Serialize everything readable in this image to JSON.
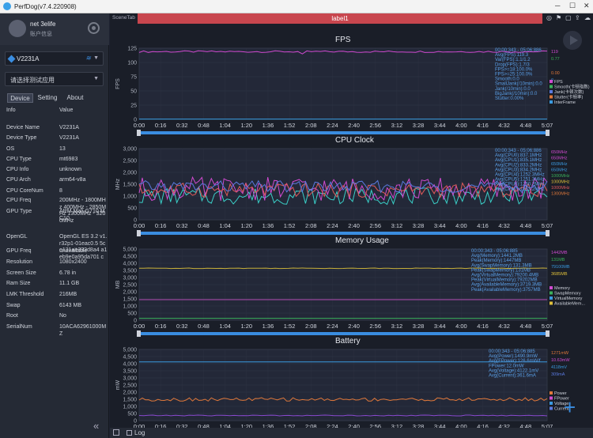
{
  "window": {
    "title": "PerfDog(v7.4.220908)"
  },
  "user": {
    "name": "net 3elife",
    "subtitle": "账户信息"
  },
  "device": {
    "name": "V2231A"
  },
  "app_select": {
    "placeholder": "请选择测试应用"
  },
  "tabs": [
    "Device",
    "Setting",
    "About"
  ],
  "table": {
    "headers": [
      "Info",
      "Value"
    ],
    "rows": [
      [
        "Device Name",
        "V2231A"
      ],
      [
        "Device Type",
        "V2231A"
      ],
      [
        "OS",
        "13"
      ],
      [
        "CPU Type",
        "mt6983"
      ],
      [
        "CPU Info",
        "unknown"
      ],
      [
        "CPU Arch",
        "arm64-v8a"
      ],
      [
        "CPU CoreNum",
        "8"
      ],
      [
        "CPU Freq",
        "200MHz - 1800MHz 400MHz - 2850MHz 1300MHz - 3200MHz"
      ],
      [
        "GPU Type",
        "ARM Mali-G710 MC10"
      ],
      [
        "OpenGL",
        "OpenGL ES 3.2 v1.r32p1-01eac0.5 5ce131ae332d8a4 a1eb9e0a95da701 c"
      ],
      [
        "GPU Freq",
        "unavailable"
      ],
      [
        "Resolution",
        "1080x2400"
      ],
      [
        "Screen Size",
        "6.78 in"
      ],
      [
        "Ram Size",
        "11.1 GB"
      ],
      [
        "LMK Threshold",
        "216MB"
      ],
      [
        "Swap",
        "6143 MB"
      ],
      [
        "Root",
        "No"
      ],
      [
        "SerialNum",
        "10ACA62961000MZ"
      ]
    ]
  },
  "scene_tab": "SceneTab",
  "label_bar": "label1",
  "log_label": "Log",
  "time_ticks": [
    "0:00",
    "0:16",
    "0:32",
    "0:48",
    "1:04",
    "1:20",
    "1:36",
    "1:52",
    "2:08",
    "2:24",
    "2:40",
    "2:56",
    "3:12",
    "3:28",
    "3:44",
    "4:00",
    "4:16",
    "4:32",
    "4:48",
    "5:07"
  ],
  "chart_data": [
    {
      "type": "line",
      "title": "FPS",
      "ylabel": "FPS",
      "ylim": [
        0,
        125
      ],
      "yticks": [
        0,
        25,
        50,
        75,
        100,
        125
      ],
      "readout": [
        "00:00:343 - 05:06:886",
        "Avg(FPS):119.3",
        "Var(FPS):1.1/1.2",
        "Drop(FPS):1.7/3",
        "FPS>=18:100.0%",
        "FPS>=25:100.0%",
        "Smooth:0.0",
        "SmallJank(/10min):0.0",
        "Jank(/10min):0.0",
        "BigJank(/10min):0.0",
        "Stutter:0.00%"
      ],
      "legend": [
        "FPS",
        "Smooth(卡顿指数)",
        "Jank(卡顿次数)",
        "Stutter(卡顿率)",
        "InterFrame"
      ],
      "legend_colors": [
        "#d04ad0",
        "#3ab05a",
        "#5a7ae0",
        "#e0783a",
        "#3a9ae0"
      ],
      "current_values": [
        "119",
        "0.77",
        "",
        "0.00",
        "0"
      ],
      "series": [
        {
          "name": "FPS",
          "color": "#d04ad0",
          "level": 119,
          "jitter": 1.5
        },
        {
          "name": "InterFrame",
          "color": "#3a9ae0",
          "level": 0.5,
          "jitter": 0
        }
      ]
    },
    {
      "type": "line",
      "title": "CPU Clock",
      "ylabel": "MHz",
      "ylim": [
        0,
        3000
      ],
      "yticks": [
        0,
        500,
        1000,
        1500,
        2000,
        2500,
        3000
      ],
      "readout": [
        "00:00:343 - 05:06:886",
        "Avg(CPU0):837.1MHz",
        "Avg(CPU1):835.1MHz",
        "Avg(CPU2):833.2MHz",
        "Avg(CPU3):834.2MHz",
        "Avg(CPU4):1252.3MHz",
        "Avg(CPU5):1251.3MHz",
        "Avg(CPU6):1250.2MHz",
        "Avg(CPU7):1253.2MHz"
      ],
      "legend": [],
      "legend_colors": [],
      "current_values": [
        "650MHz",
        "650MHz",
        "650MHz",
        "650MHz",
        "1000MHz",
        "1000MHz",
        "1000MHz",
        "1300MHz"
      ],
      "value_colors": [
        "#d04ad0",
        "#d04ad0",
        "#3a9ae0",
        "#3a9ae0",
        "#3ab05a",
        "#e0c03a",
        "#e05a5a",
        "#e0783a"
      ],
      "series": [
        {
          "name": "CPU0",
          "color": "#3ad0c8",
          "level": 1000,
          "jitter": 350
        },
        {
          "name": "CPU4",
          "color": "#d04ad0",
          "level": 1300,
          "jitter": 500
        },
        {
          "name": "CPU6",
          "color": "#e05a5a",
          "level": 1250,
          "jitter": 300
        },
        {
          "name": "CPU7",
          "color": "#5a7ae0",
          "level": 1400,
          "jitter": 250
        }
      ]
    },
    {
      "type": "line",
      "title": "Memory Usage",
      "ylabel": "MB",
      "ylim": [
        0,
        5000
      ],
      "yticks": [
        0,
        500,
        1000,
        1500,
        2000,
        2500,
        3000,
        3500,
        4000,
        4500,
        5000
      ],
      "readout": [
        "00:00:343 - 05:06:885",
        "Avg(Memory):1441.2MB",
        "Peak(Memory):1447MB",
        "Avg(SwapMemory):131.3MB",
        "Peak(SwapMemory):131MB",
        "Avg(VirtualMemory):79200.4MB",
        "Peak(VirtualMemory):79202MB",
        "Avg(AvailableMemory):3719.3MB",
        "Peak(AvailableMemory):3757MB"
      ],
      "legend": [
        "Memory",
        "SwapMemory",
        "VirtualMemory",
        "AvailableMem..."
      ],
      "legend_colors": [
        "#d04ad0",
        "#3ab05a",
        "#3a9ae0",
        "#e0c03a"
      ],
      "current_values": [
        "1442MB",
        "131MB",
        "79100MB",
        "3685MB"
      ],
      "series": [
        {
          "name": "AvailableMemory",
          "color": "#c8b03a",
          "level": 3650,
          "jitter": 20
        },
        {
          "name": "Memory",
          "color": "#b04ab0",
          "level": 1442,
          "jitter": 0
        },
        {
          "name": "SwapMemory",
          "color": "#3ab05a",
          "level": 131,
          "jitter": 0
        }
      ]
    },
    {
      "type": "line",
      "title": "Battery",
      "ylabel": "mW",
      "ylim": [
        0,
        5000
      ],
      "yticks": [
        0,
        500,
        1000,
        1500,
        2000,
        2500,
        3000,
        3500,
        4000,
        4500,
        5000
      ],
      "readout": [
        "00:00:343 - 05:06:885",
        "Avg(Power):1490.9mW",
        "Avg(FPower):126.6mW/f",
        "FPower:12.0mW",
        "Avg(Voltage):4122.1mV",
        "Avg(Current):361.6mA"
      ],
      "legend": [
        "Power",
        "FPower",
        "Voltage",
        "Current"
      ],
      "legend_colors": [
        "#e0783a",
        "#d04ad0",
        "#3a9ae0",
        "#5a7ae0"
      ],
      "current_values": [
        "1271mW",
        "10.63mW",
        "4118mV",
        "309mA"
      ],
      "series": [
        {
          "name": "Voltage",
          "color": "#3a9ae0",
          "level": 4120,
          "jitter": 0
        },
        {
          "name": "Power",
          "color": "#e0783a",
          "level": 1490,
          "jitter": 120
        },
        {
          "name": "Current",
          "color": "#8a4ad0",
          "level": 361,
          "jitter": 30
        }
      ]
    }
  ]
}
